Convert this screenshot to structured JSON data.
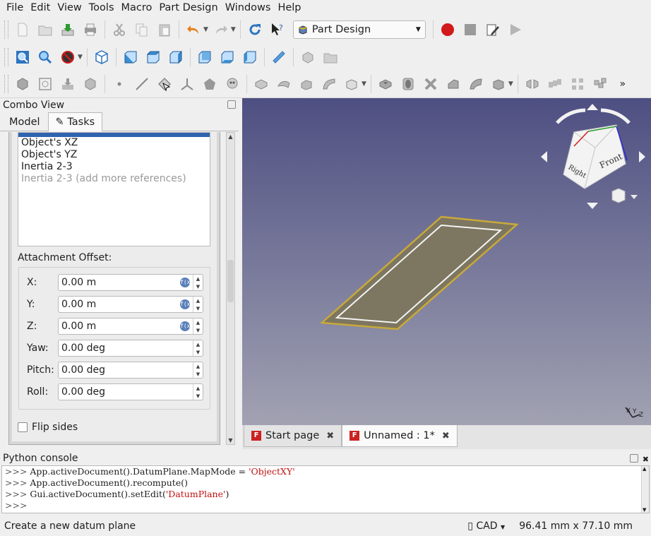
{
  "menu": [
    "File",
    "Edit",
    "View",
    "Tools",
    "Macro",
    "Part Design",
    "Windows",
    "Help"
  ],
  "workbench": {
    "selected": "Part Design"
  },
  "combo_view": {
    "title": "Combo View",
    "tabs": [
      "Model",
      "Tasks"
    ],
    "references": [
      "Object's XZ",
      "Object's  YZ",
      "Inertia 2-3",
      "Inertia 2-3 (add more references)"
    ],
    "attachment_offset_label": "Attachment Offset:",
    "fields": [
      {
        "label": "X:",
        "value": "0.00 m"
      },
      {
        "label": "Y:",
        "value": "0.00 m"
      },
      {
        "label": "Z:",
        "value": "0.00 m"
      },
      {
        "label": "Yaw:",
        "value": "0.00 deg"
      },
      {
        "label": "Pitch:",
        "value": "0.00 deg"
      },
      {
        "label": "Roll:",
        "value": "0.00 deg"
      }
    ],
    "flip_sides": "Flip sides"
  },
  "view_tabs": [
    "Start page",
    "Unnamed : 1*"
  ],
  "navcube": {
    "front": "Front",
    "right": "Right"
  },
  "axis": {
    "x": "X",
    "y": "Y",
    "z": "Z"
  },
  "python_console": {
    "title": "Python console",
    "lines": [
      {
        "prompt": ">>> ",
        "code": "App.activeDocument().DatumPlane.MapMode = ",
        "str": "'ObjectXY'"
      },
      {
        "prompt": ">>> ",
        "code": "App.activeDocument().recompute()",
        "str": ""
      },
      {
        "prompt": ">>> ",
        "code": "Gui.activeDocument().setEdit(",
        "str": "'DatumPlane'",
        "tail": ")"
      },
      {
        "prompt": ">>> ",
        "code": "",
        "str": ""
      }
    ]
  },
  "status": {
    "message": "Create a new datum plane",
    "nav": "CAD",
    "dims": "96.41 mm x 77.10 mm"
  }
}
